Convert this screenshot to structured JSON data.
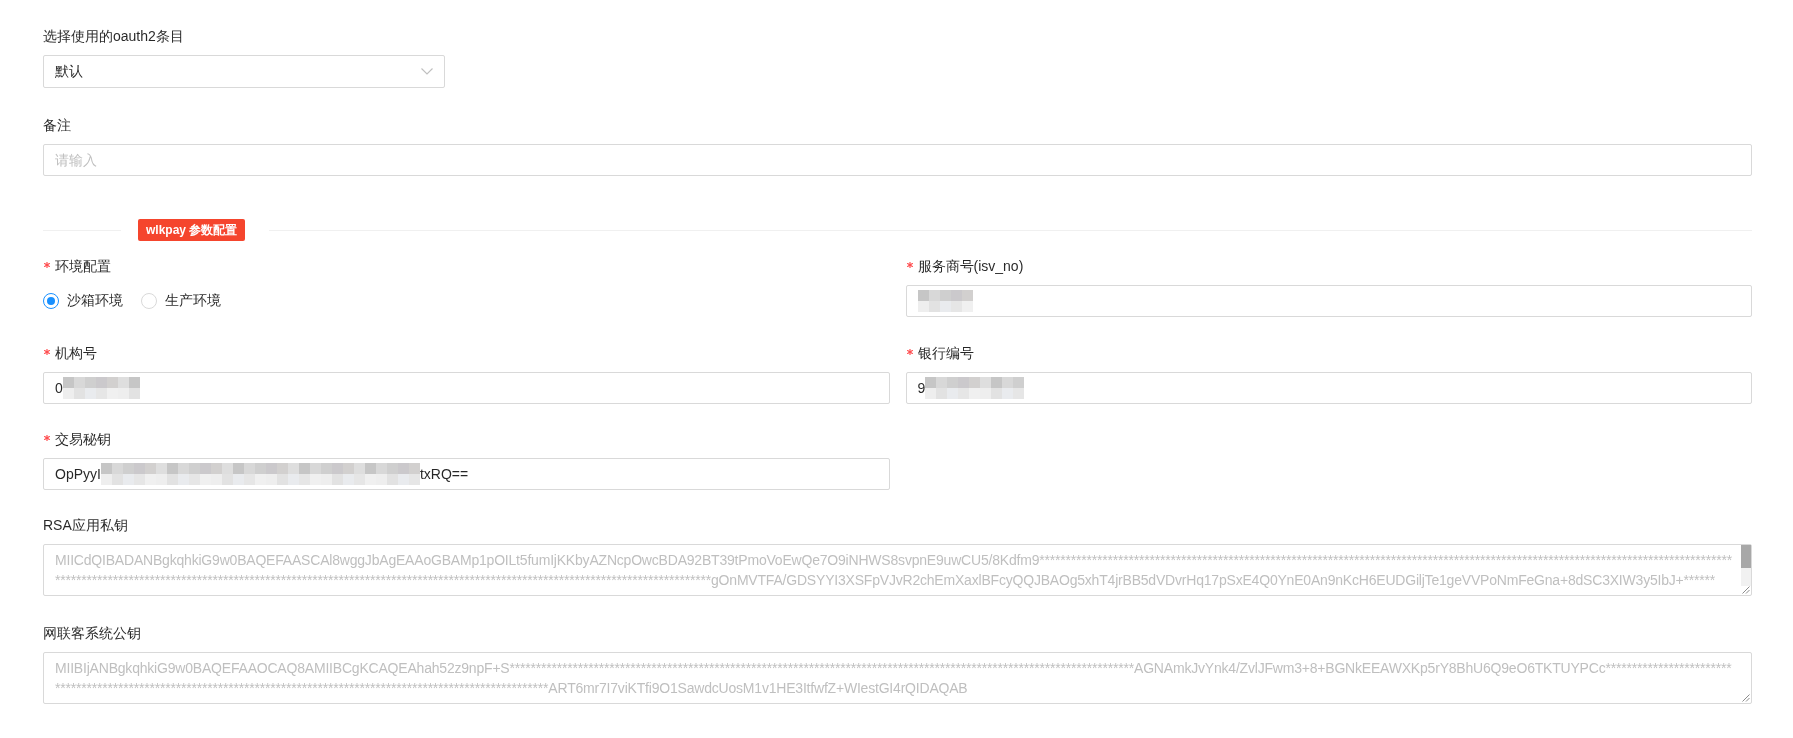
{
  "oauth2_select": {
    "label": "选择使用的oauth2条目",
    "value": "默认"
  },
  "remark": {
    "label": "备注",
    "placeholder": "请输入"
  },
  "params_section": {
    "title": "wlkpay 参数配置",
    "fields": [
      {
        "kind": "radio",
        "label": "环境配置",
        "required": true,
        "options": [
          {
            "label": "沙箱环境",
            "selected": true
          },
          {
            "label": "生产环境",
            "selected": false
          }
        ]
      },
      {
        "kind": "input",
        "label": "服务商号(isv_no)",
        "required": true,
        "redacted": true
      },
      {
        "kind": "input",
        "label": "机构号",
        "required": true,
        "value": "0",
        "redacted": true
      },
      {
        "kind": "input",
        "label": "银行编号",
        "required": true,
        "value": "9",
        "redacted": true
      },
      {
        "kind": "input",
        "label": "交易秘钥",
        "required": true,
        "value": "OpPyyI",
        "value_tail": "txRQ==",
        "redacted": true
      }
    ]
  },
  "keys": [
    {
      "label": "RSA应用私钥",
      "placeholder": "MIICdQIBADANBgkqhkiG9w0BAQEFAASCAl8wggJbAgEAAoGBAMp1pOILt5fumIjKKbyAZNcpOwcBDA92BT39tPmoVoEwQe7O9iNHWS8svpnE9uwCU5/8Kdfm9*****************************************************************************************************************************************************************************************************************************************************************gOnMVTFA/GDSYYI3XSFpVJvR2chEmXaxlBFcyQQJBAOg5xhT4jrBB5dVDvrHq17pSxE4Q0YnE0An9nKcH6EUDGiljTe1geVVPoNmFeGna+8dSC3XIW3y5IbJ+******",
      "scrollbar": true
    },
    {
      "label": "网联客系统公钥",
      "placeholder": "MIIBIjANBgkqhkiG9w0BAQEFAAOCAQ8AMIIBCgKCAQEAhah52z9npF+S***********************************************************************************************************************AGNAmkJvYnk4/ZvlJFwm3+8+BGNkEEAWXKp5rY8BhU6Q9eO6TKTUYPCc**********************************************************************************************************************ART6mr7I7viKTfi9O1SawdcUosM1v1HE3ItfwfZ+WIestGI4rQIDAQAB",
      "scrollbar": false
    }
  ]
}
